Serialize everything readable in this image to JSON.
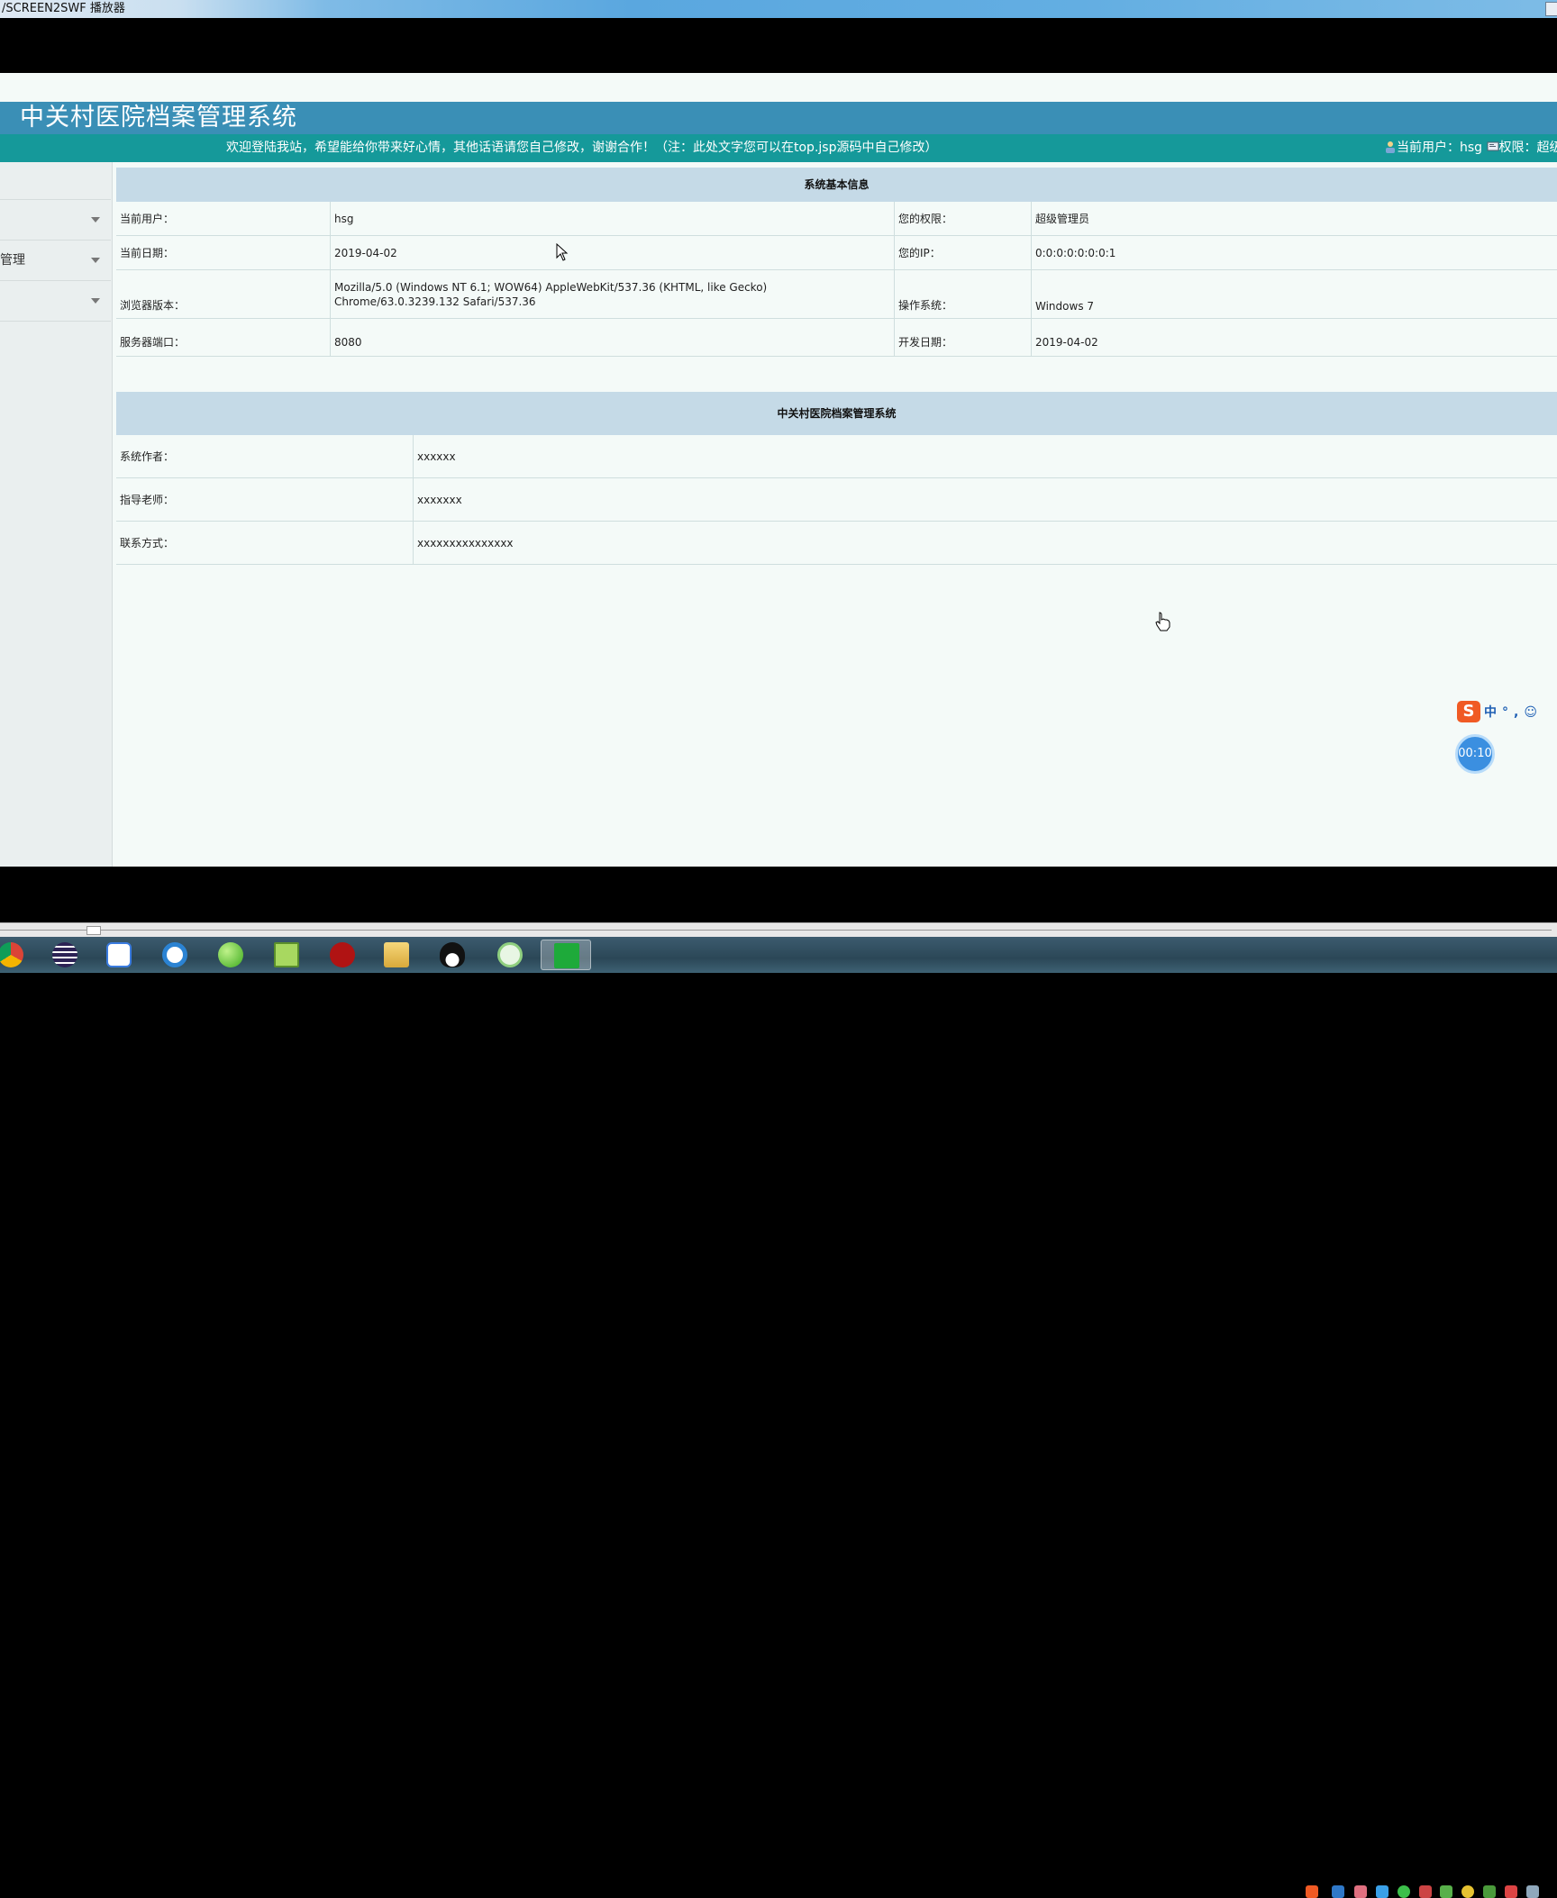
{
  "window": {
    "title": "/SCREEN2SWF 播放器"
  },
  "header": {
    "system_title": "中关村医院档案管理系统",
    "welcome": "欢迎登陆我站，希望能给你带来好心情，其他话语请您自己修改，谢谢合作！（注：此处文字您可以在top.jsp源码中自己修改）",
    "current_user_text": "当前用户：hsg",
    "permission_text": "权限：超级"
  },
  "sidebar": {
    "items": [
      {
        "label": ""
      },
      {
        "label": "管理"
      },
      {
        "label": ""
      }
    ]
  },
  "system_info": {
    "title": "系统基本信息",
    "rows": [
      {
        "label1": "当前用户：",
        "value1": "hsg",
        "label2": "您的权限：",
        "value2": "超级管理员"
      },
      {
        "label1": "当前日期：",
        "value1": "2019-04-02",
        "label2": "您的IP：",
        "value2": "0:0:0:0:0:0:0:1"
      },
      {
        "label1": "浏览器版本：",
        "value1": "Mozilla/5.0 (Windows NT 6.1; WOW64) AppleWebKit/537.36 (KHTML, like Gecko) Chrome/63.0.3239.132 Safari/537.36",
        "label2": "操作系统：",
        "value2": "Windows 7"
      },
      {
        "label1": "服务器端口：",
        "value1": "8080",
        "label2": "开发日期：",
        "value2": "2019-04-02"
      }
    ]
  },
  "about": {
    "title": "中关村医院档案管理系统",
    "rows": [
      {
        "label": "系统作者：",
        "value": "xxxxxx"
      },
      {
        "label": "指导老师：",
        "value": "xxxxxxx"
      },
      {
        "label": "联系方式：",
        "value": "xxxxxxxxxxxxxxx"
      }
    ]
  },
  "widgets": {
    "ime_logo": "S",
    "ime_text": "中°,☺",
    "timer": "00:10"
  },
  "taskbar": {
    "icons": [
      "chrome-icon",
      "eclipse-icon",
      "baidu-netdisk-icon",
      "browser-icon",
      "leaf-app-icon",
      "notepad-icon",
      "flash-icon",
      "file-explorer-icon",
      "qq-icon",
      "wechat-icon",
      "screen2swf-icon"
    ]
  },
  "colors": {
    "banner": "#3a8fb6",
    "marquee": "#15999a",
    "table_header": "#c5dae7",
    "page_bg": "#f4faf8"
  }
}
